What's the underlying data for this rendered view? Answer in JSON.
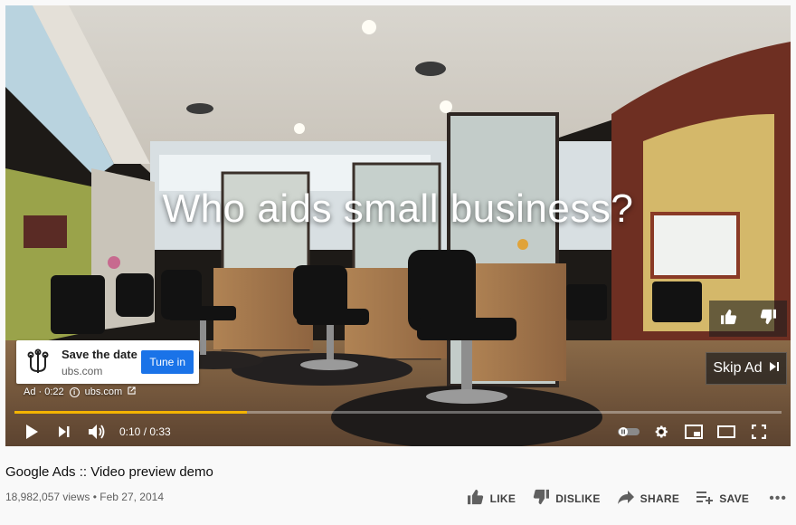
{
  "overlay": {
    "headline": "Who aids small business?"
  },
  "ad": {
    "title": "Save the date",
    "domain": "ubs.com",
    "cta_label": "Tune in",
    "badge": "Ad · 0:22",
    "display_url": "ubs.com"
  },
  "skip": {
    "label": "Skip Ad"
  },
  "player": {
    "progress_fraction": 0.303,
    "time": "0:10 / 0:33",
    "progress_color": "#f4b400"
  },
  "video": {
    "title": "Google Ads :: Video preview demo",
    "meta": "18,982,057 views • Feb 27, 2014"
  },
  "actions": {
    "like": "LIKE",
    "dislike": "DISLIKE",
    "share": "SHARE",
    "save": "SAVE",
    "more": "•••"
  },
  "icons": [
    "play-icon",
    "next-icon",
    "volume-icon",
    "autoplay-toggle-icon",
    "settings-icon",
    "miniplayer-icon",
    "theater-icon",
    "fullscreen-icon",
    "thumbs-up-icon",
    "thumbs-down-icon",
    "share-icon",
    "save-playlist-icon",
    "skip-icon",
    "ubs-logo-icon",
    "info-icon",
    "external-link-icon"
  ]
}
